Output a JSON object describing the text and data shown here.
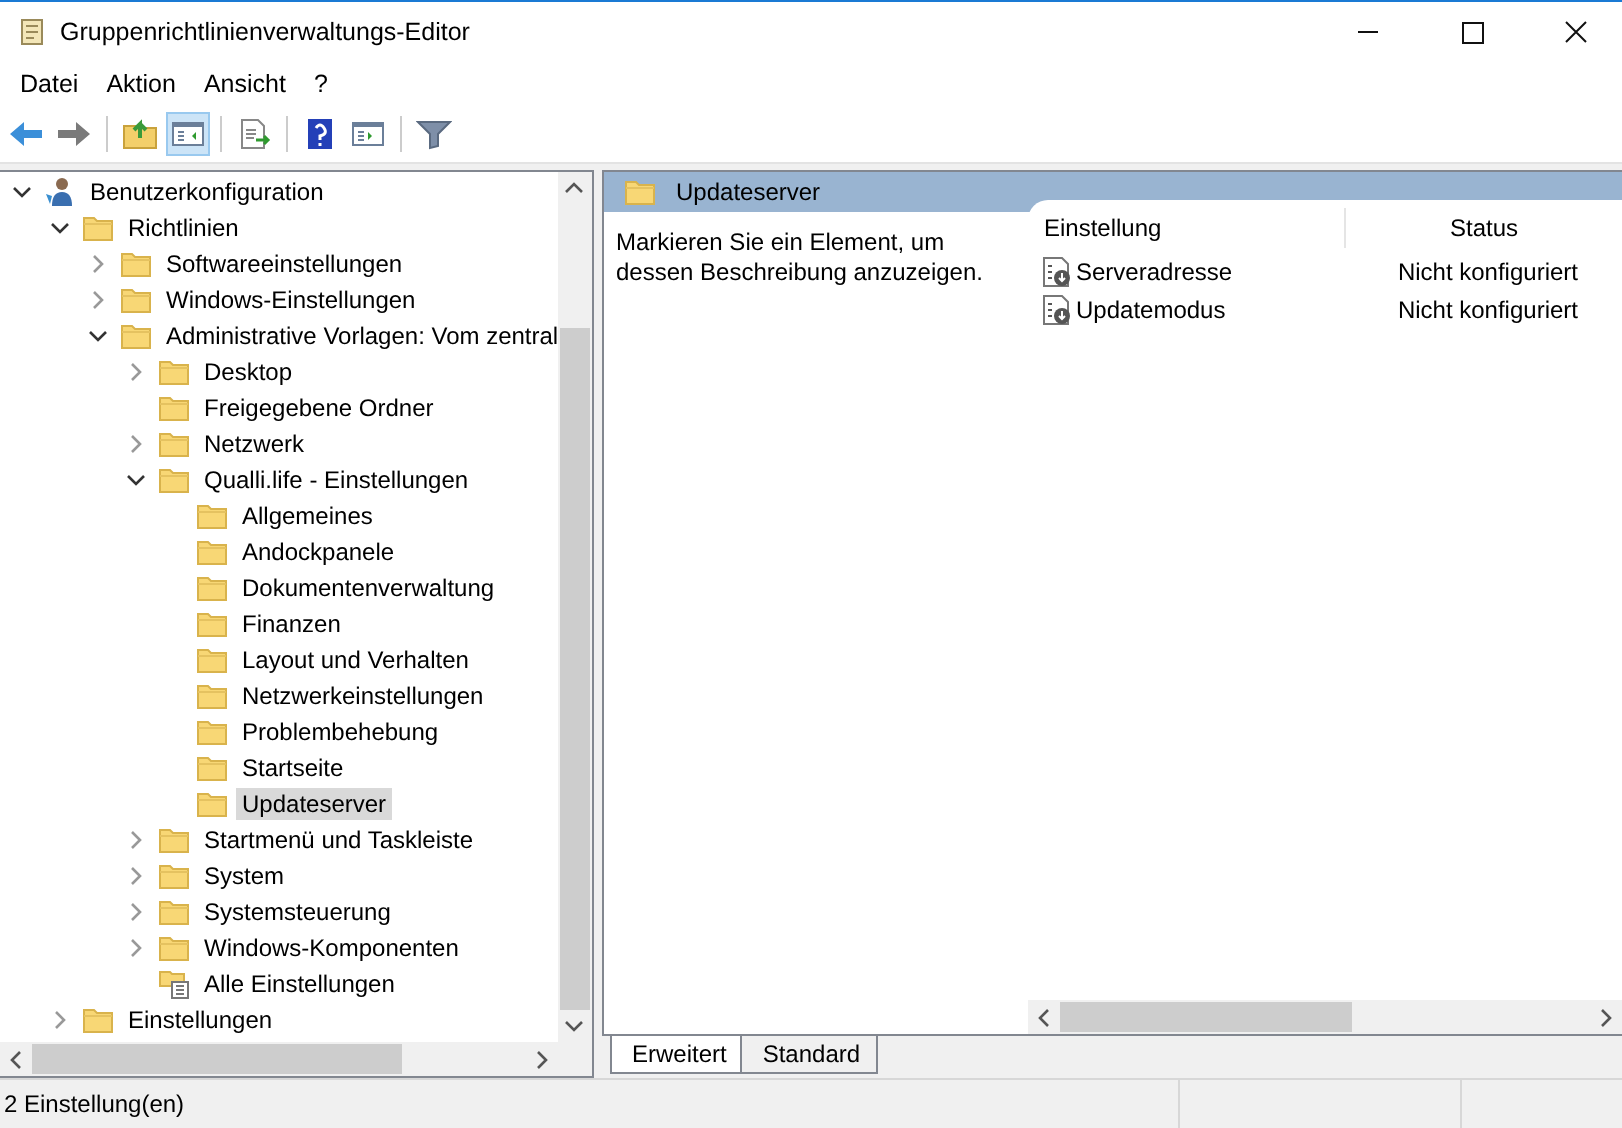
{
  "window": {
    "title": "Gruppenrichtlinienverwaltungs-Editor"
  },
  "menu": [
    "Datei",
    "Aktion",
    "Ansicht",
    "?"
  ],
  "toolbar": [
    {
      "kind": "back",
      "pressed": false
    },
    {
      "kind": "forward",
      "pressed": false
    },
    {
      "kind": "up",
      "pressed": false
    },
    {
      "kind": "pane",
      "pressed": true
    },
    {
      "kind": "export",
      "pressed": false
    },
    {
      "kind": "help",
      "pressed": false
    },
    {
      "kind": "pane2",
      "pressed": false
    },
    {
      "kind": "filter",
      "pressed": false
    }
  ],
  "tree": [
    {
      "label": "Benutzerkonfiguration",
      "kind": "user",
      "expanded": true,
      "selected": false,
      "children": [
        {
          "label": "Richtlinien",
          "kind": "folder",
          "expanded": true,
          "selected": false,
          "children": [
            {
              "label": "Softwareeinstellungen",
              "kind": "folder",
              "expanded": false,
              "selected": false
            },
            {
              "label": "Windows-Einstellungen",
              "kind": "folder",
              "expanded": false,
              "selected": false
            },
            {
              "label": "Administrative Vorlagen: Vom zentral",
              "kind": "folder",
              "expanded": true,
              "selected": false,
              "children": [
                {
                  "label": "Desktop",
                  "kind": "folder",
                  "expanded": false,
                  "selected": false
                },
                {
                  "label": "Freigegebene Ordner",
                  "kind": "folder",
                  "selected": false
                },
                {
                  "label": "Netzwerk",
                  "kind": "folder",
                  "expanded": false,
                  "selected": false
                },
                {
                  "label": "Qualli.life - Einstellungen",
                  "kind": "folder",
                  "expanded": true,
                  "selected": false,
                  "children": [
                    {
                      "label": "Allgemeines",
                      "kind": "folder",
                      "selected": false
                    },
                    {
                      "label": "Andockpanele",
                      "kind": "folder",
                      "selected": false
                    },
                    {
                      "label": "Dokumentenverwaltung",
                      "kind": "folder",
                      "selected": false
                    },
                    {
                      "label": "Finanzen",
                      "kind": "folder",
                      "selected": false
                    },
                    {
                      "label": "Layout und Verhalten",
                      "kind": "folder",
                      "selected": false
                    },
                    {
                      "label": "Netzwerkeinstellungen",
                      "kind": "folder",
                      "selected": false
                    },
                    {
                      "label": "Problembehebung",
                      "kind": "folder",
                      "selected": false
                    },
                    {
                      "label": "Startseite",
                      "kind": "folder",
                      "selected": false
                    },
                    {
                      "label": "Updateserver",
                      "kind": "folder",
                      "selected": true
                    }
                  ]
                },
                {
                  "label": "Startmenü und Taskleiste",
                  "kind": "folder",
                  "expanded": false,
                  "selected": false
                },
                {
                  "label": "System",
                  "kind": "folder",
                  "expanded": false,
                  "selected": false
                },
                {
                  "label": "Systemsteuerung",
                  "kind": "folder",
                  "expanded": false,
                  "selected": false
                },
                {
                  "label": "Windows-Komponenten",
                  "kind": "folder",
                  "expanded": false,
                  "selected": false
                },
                {
                  "label": "Alle Einstellungen",
                  "kind": "all-settings",
                  "selected": false
                }
              ]
            }
          ]
        },
        {
          "label": "Einstellungen",
          "kind": "folder",
          "expanded": false,
          "selected": false
        }
      ]
    }
  ],
  "details": {
    "title": "Updateserver",
    "description": "Markieren Sie ein Element, um dessen Beschreibung anzuzeigen.",
    "columns": [
      "Einstellung",
      "Status"
    ],
    "rows": [
      {
        "name": "Serveradresse",
        "status": "Nicht konfiguriert"
      },
      {
        "name": "Updatemodus",
        "status": "Nicht konfiguriert"
      }
    ]
  },
  "tabs": [
    {
      "label": "Erweitert",
      "selected": true
    },
    {
      "label": "Standard",
      "selected": false
    }
  ],
  "status_bar": "2 Einstellung(en)"
}
